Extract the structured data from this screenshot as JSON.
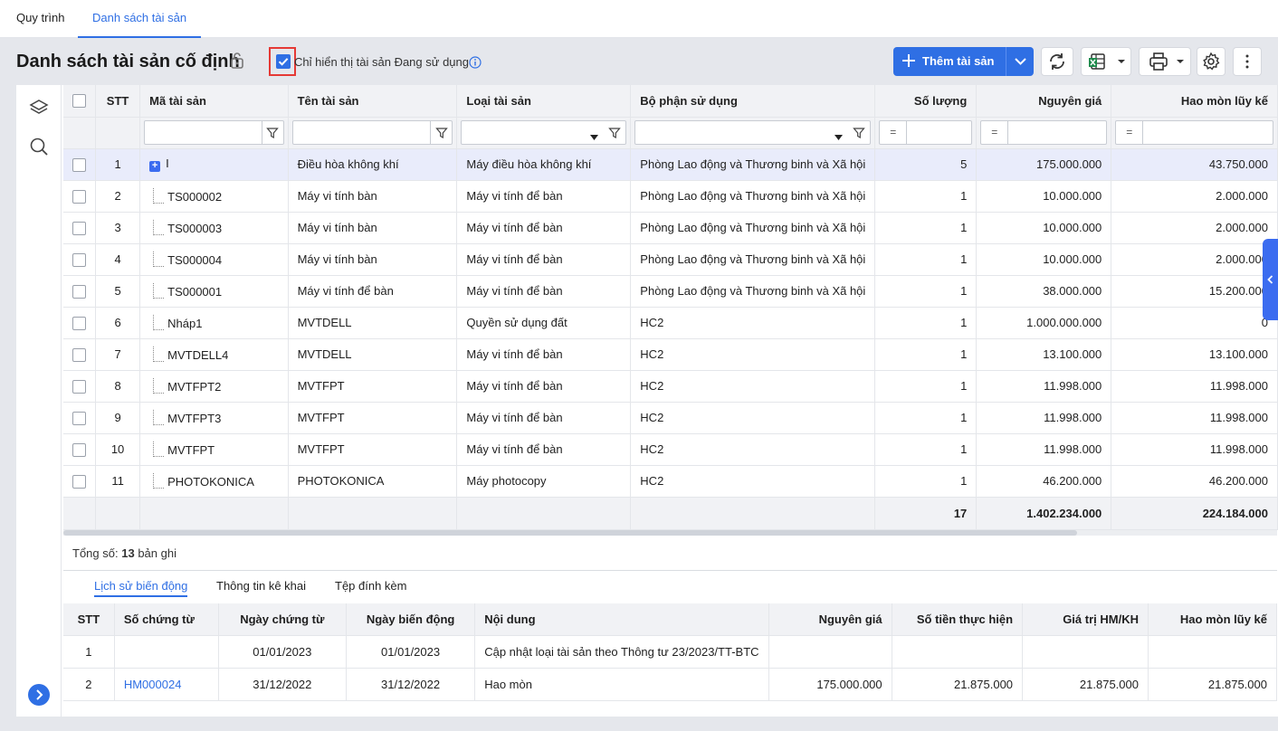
{
  "top_tabs": [
    {
      "label": "Quy trình",
      "active": false
    },
    {
      "label": "Danh sách tài sản",
      "active": true
    }
  ],
  "header": {
    "title": "Danh sách tài sản cố định",
    "filter_checkbox_label": "Chỉ hiển thị tài sản Đang sử dụng",
    "filter_checked": true
  },
  "toolbar": {
    "add_label": "Thêm tài sản",
    "icons": [
      "refresh-icon",
      "excel-icon",
      "print-icon",
      "settings-icon",
      "more-icon"
    ]
  },
  "grid": {
    "columns": [
      "STT",
      "Mã tài sản",
      "Tên tài sản",
      "Loại tài sản",
      "Bộ phận sử dụng",
      "Số lượng",
      "Nguyên giá",
      "Hao mòn lũy kế"
    ],
    "filter_eq": "=",
    "rows": [
      {
        "stt": "1",
        "code": "I",
        "name": "Điều hòa không khí",
        "type": "Máy điều hòa không khí",
        "dept": "Phòng Lao động và Thương binh và Xã hội",
        "qty": "5",
        "cost": "175.000.000",
        "dep": "43.750.000",
        "parent": true
      },
      {
        "stt": "2",
        "code": "TS000002",
        "name": "Máy vi tính bàn",
        "type": "Máy vi tính để bàn",
        "dept": "Phòng Lao động và Thương binh và Xã hội",
        "qty": "1",
        "cost": "10.000.000",
        "dep": "2.000.000"
      },
      {
        "stt": "3",
        "code": "TS000003",
        "name": "Máy vi tính bàn",
        "type": "Máy vi tính để bàn",
        "dept": "Phòng Lao động và Thương binh và Xã hội",
        "qty": "1",
        "cost": "10.000.000",
        "dep": "2.000.000"
      },
      {
        "stt": "4",
        "code": "TS000004",
        "name": "Máy vi tính bàn",
        "type": "Máy vi tính để bàn",
        "dept": "Phòng Lao động và Thương binh và Xã hội",
        "qty": "1",
        "cost": "10.000.000",
        "dep": "2.000.000"
      },
      {
        "stt": "5",
        "code": "TS000001",
        "name": "Máy vi tính để bàn",
        "type": "Máy vi tính để bàn",
        "dept": "Phòng Lao động và Thương binh và Xã hội",
        "qty": "1",
        "cost": "38.000.000",
        "dep": "15.200.000"
      },
      {
        "stt": "6",
        "code": "Nháp1",
        "name": "MVTDELL",
        "type": "Quyền sử dụng đất",
        "dept": "HC2",
        "qty": "1",
        "cost": "1.000.000.000",
        "dep": "0"
      },
      {
        "stt": "7",
        "code": "MVTDELL4",
        "name": "MVTDELL",
        "type": "Máy vi tính để bàn",
        "dept": "HC2",
        "qty": "1",
        "cost": "13.100.000",
        "dep": "13.100.000"
      },
      {
        "stt": "8",
        "code": "MVTFPT2",
        "name": "MVTFPT",
        "type": "Máy vi tính để bàn",
        "dept": "HC2",
        "qty": "1",
        "cost": "11.998.000",
        "dep": "11.998.000"
      },
      {
        "stt": "9",
        "code": "MVTFPT3",
        "name": "MVTFPT",
        "type": "Máy vi tính để bàn",
        "dept": "HC2",
        "qty": "1",
        "cost": "11.998.000",
        "dep": "11.998.000"
      },
      {
        "stt": "10",
        "code": "MVTFPT",
        "name": "MVTFPT",
        "type": "Máy vi tính để bàn",
        "dept": "HC2",
        "qty": "1",
        "cost": "11.998.000",
        "dep": "11.998.000"
      },
      {
        "stt": "11",
        "code": "PHOTOKONICA",
        "name": "PHOTOKONICA",
        "type": "Máy photocopy",
        "dept": "HC2",
        "qty": "1",
        "cost": "46.200.000",
        "dep": "46.200.000"
      }
    ],
    "footer": {
      "qty": "17",
      "cost": "1.402.234.000",
      "dep": "224.184.000"
    }
  },
  "summary": {
    "prefix": "Tổng số:",
    "count": "13",
    "suffix": "bản ghi"
  },
  "bottom": {
    "tabs": [
      {
        "label": "Lịch sử biến động",
        "active": true
      },
      {
        "label": "Thông tin kê khai",
        "active": false
      },
      {
        "label": "Tệp đính kèm",
        "active": false
      }
    ],
    "columns": [
      "STT",
      "Số chứng từ",
      "Ngày chứng từ",
      "Ngày biến động",
      "Nội dung",
      "Nguyên giá",
      "Số tiền thực hiện",
      "Giá trị HM/KH",
      "Hao mòn lũy kế"
    ],
    "rows": [
      {
        "stt": "1",
        "doc": "",
        "doc_date": "01/01/2023",
        "change_date": "01/01/2023",
        "content": "Cập nhật loại tài sản theo Thông tư 23/2023/TT-BTC",
        "cost": "",
        "amount": "",
        "hmkh": "",
        "dep": ""
      },
      {
        "stt": "2",
        "doc": "HM000024",
        "doc_date": "31/12/2022",
        "change_date": "31/12/2022",
        "content": "Hao mòn",
        "cost": "175.000.000",
        "amount": "21.875.000",
        "hmkh": "21.875.000",
        "dep": "21.875.000"
      }
    ]
  }
}
